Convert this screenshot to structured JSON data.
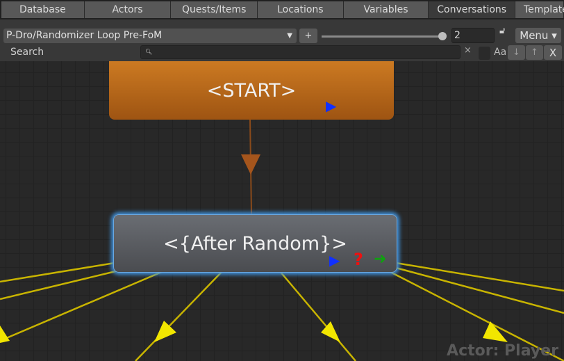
{
  "tabs": [
    {
      "label": "Database"
    },
    {
      "label": "Actors"
    },
    {
      "label": "Quests/Items"
    },
    {
      "label": "Locations"
    },
    {
      "label": "Variables"
    },
    {
      "label": "Conversations",
      "active": true
    },
    {
      "label": "Templates"
    }
  ],
  "toolbar": {
    "conversation": "P-Dro/Randomizer Loop Pre-FoM",
    "add_label": "+",
    "zoom_value": "2",
    "menu_label": "Menu ▾",
    "search_label": "Search",
    "search_value": "",
    "clear_label": "×",
    "match_case_label": "Aa",
    "down_label": "↓",
    "up_label": "↑",
    "close_label": "X"
  },
  "nodes": {
    "start": "<START>",
    "after": "<{After Random}>"
  },
  "watermark": "Actor: Player",
  "colors": {
    "start": "#b86a1c",
    "link_start": "#8a4a1a",
    "link": "#c8b400",
    "arrow": "#f2e600",
    "selected_glow": "#3f8fd8"
  }
}
